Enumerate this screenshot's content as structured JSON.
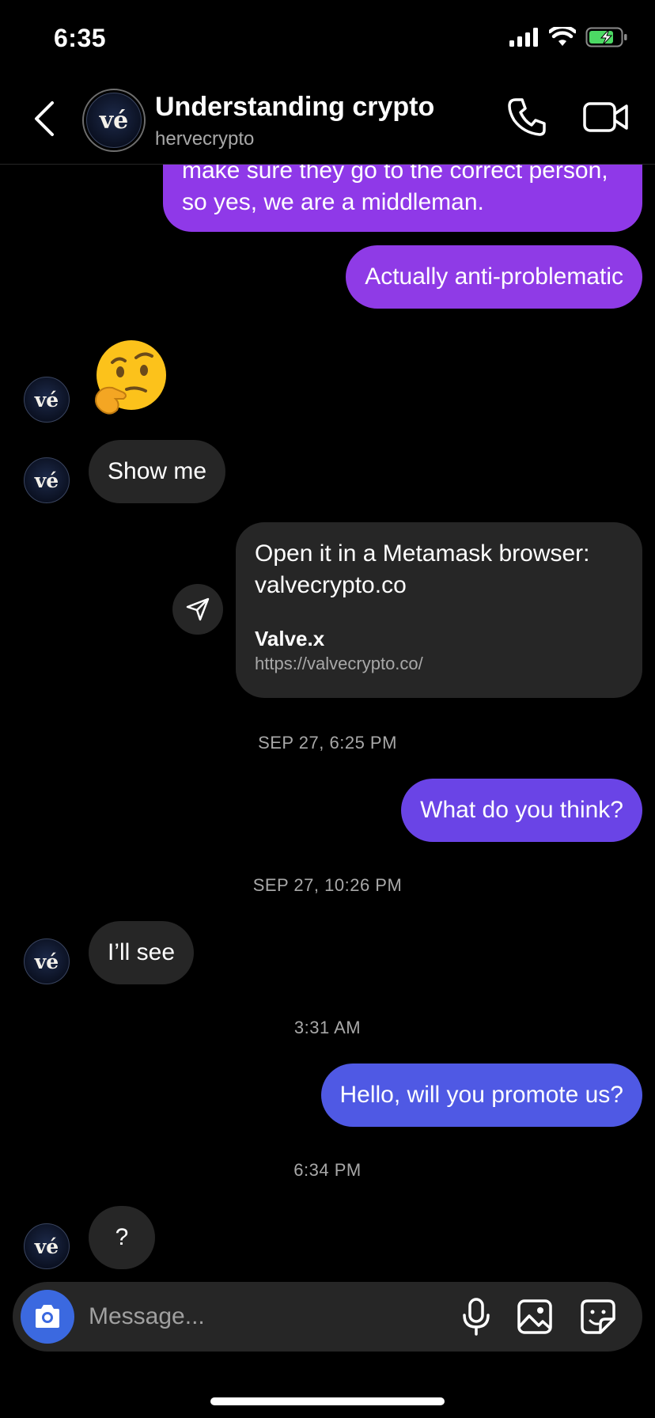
{
  "status_bar": {
    "time": "6:35"
  },
  "header": {
    "title": "Understanding crypto",
    "subtitle": "hervecrypto",
    "avatar_text": "vé"
  },
  "messages": {
    "out_top": "make sure they go to the correct person, so yes, we are a middleman.",
    "out_1": "Actually anti-problematic",
    "in_1": "Show me",
    "link_message": {
      "text": "Open it in a Metamask browser: valvecrypto.co",
      "preview_title": "Valve.x",
      "preview_url": "https://valvecrypto.co/"
    },
    "out_2": "What do you think?",
    "in_2": "I’ll see",
    "out_3": "Hello, will you promote us?",
    "in_3": "?"
  },
  "timestamps": [
    "SEP 27, 6:25 PM",
    "SEP 27, 10:26 PM",
    "3:31 AM",
    "6:34 PM"
  ],
  "composer": {
    "placeholder": "Message..."
  },
  "colors": {
    "bubble_purple": "#8f3be6",
    "bubble_violet": "#6a44e6",
    "bubble_blue": "#4f59e4",
    "bubble_incoming": "#262626",
    "camera_button": "#3b69e0",
    "battery_green": "#4cd964"
  },
  "icons": [
    "cellular-icon",
    "wifi-icon",
    "battery-icon",
    "back-chevron-icon",
    "phone-icon",
    "video-camera-icon",
    "thinking-face-emoji",
    "share-send-icon",
    "camera-icon",
    "microphone-icon",
    "gallery-icon",
    "sticker-icon"
  ]
}
